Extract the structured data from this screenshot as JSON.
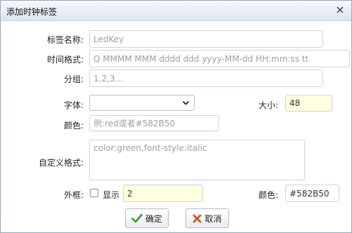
{
  "dialog": {
    "title": "添加时钟标签",
    "close_icon": "close-x-icon"
  },
  "form": {
    "tag_name": {
      "label": "标签名称:",
      "placeholder": "LedKey",
      "value": ""
    },
    "time_format": {
      "label": "时间格式:",
      "placeholder": "Q MMMM MMM dddd ddd yyyy-MM-dd HH:mm:ss tt",
      "value": ""
    },
    "group": {
      "label": "分组:",
      "placeholder": "1,2,3...",
      "value": ""
    },
    "font": {
      "label": "字体:",
      "selected": ""
    },
    "size": {
      "label": "大小:",
      "value": "48"
    },
    "color": {
      "label": "颜色:",
      "placeholder": "例:red或者#582B50",
      "value": ""
    },
    "custom_format": {
      "label": "自定义格式:",
      "placeholder": "color:green,font-style:italic",
      "value": ""
    },
    "border": {
      "label": "外框:",
      "show_label": "显示",
      "show_checked": false,
      "width_value": "2",
      "color_label": "颜色:",
      "color_value": "#582B50"
    }
  },
  "buttons": {
    "confirm_label": "确定",
    "cancel_label": "取消"
  },
  "colors": {
    "title_gradient_top": "#f6f9fc",
    "title_gradient_bottom": "#dbe5ef",
    "highlight_input": "#ffffe0",
    "confirm_check": "#3a9a2a",
    "cancel_x": "#d9541e"
  }
}
